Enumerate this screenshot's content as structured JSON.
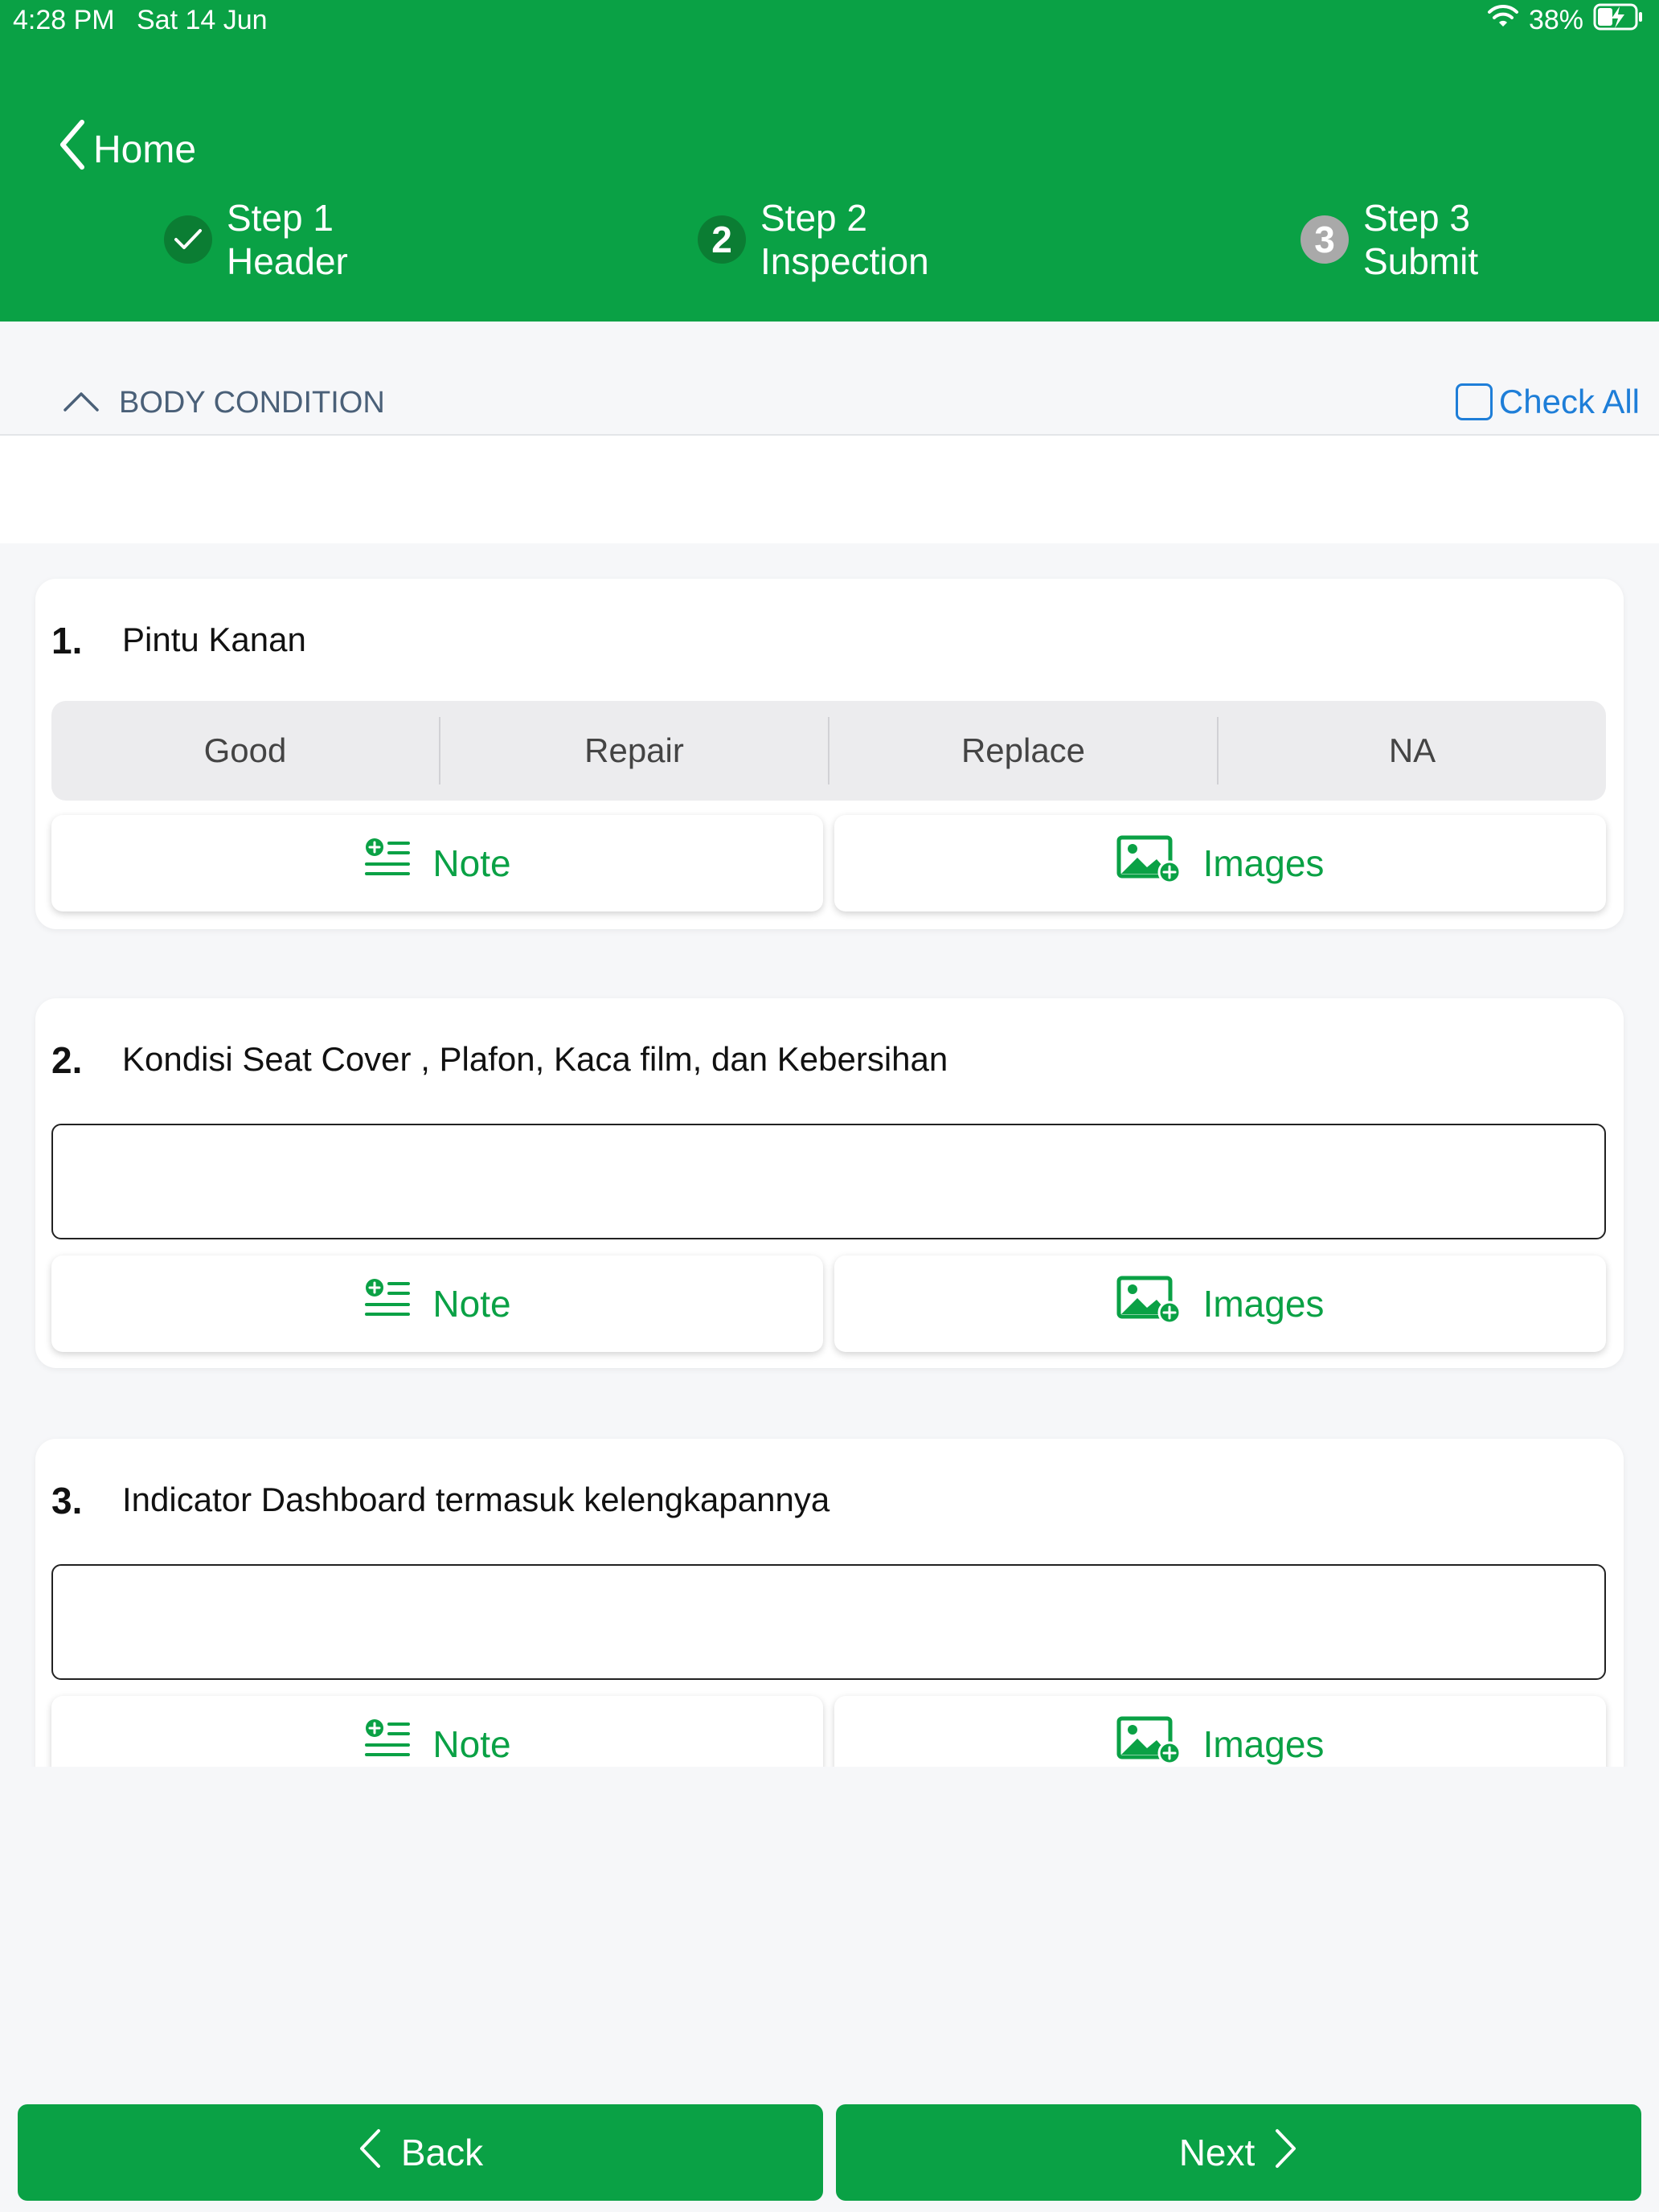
{
  "status_bar": {
    "time": "4:28 PM",
    "date": "Sat 14 Jun",
    "battery": "38%"
  },
  "nav": {
    "back_label": "Home"
  },
  "steps": [
    {
      "title": "Step 1",
      "subtitle": "Header",
      "state": "done"
    },
    {
      "number": "2",
      "title": "Step 2",
      "subtitle": "Inspection",
      "state": "active"
    },
    {
      "number": "3",
      "title": "Step 3",
      "subtitle": "Submit",
      "state": "pending"
    }
  ],
  "section": {
    "title": "BODY CONDITION",
    "check_all_label": "Check All"
  },
  "questions": [
    {
      "number": "1.",
      "text": "Pintu Kanan",
      "type": "choice",
      "options": [
        "Good",
        "Repair",
        "Replace",
        "NA"
      ]
    },
    {
      "number": "2.",
      "text": "Kondisi Seat Cover , Plafon, Kaca film, dan Kebersihan",
      "type": "text"
    },
    {
      "number": "3.",
      "text": "Indicator Dashboard termasuk kelengkapannya",
      "type": "text"
    }
  ],
  "actions": {
    "note_label": "Note",
    "images_label": "Images"
  },
  "footer": {
    "back_label": "Back",
    "next_label": "Next"
  },
  "colors": {
    "brand_green": "#0aa145",
    "link_blue": "#1e7ed8",
    "done_badge": "#0b7d33",
    "pending_badge": "#a9a9a9"
  }
}
